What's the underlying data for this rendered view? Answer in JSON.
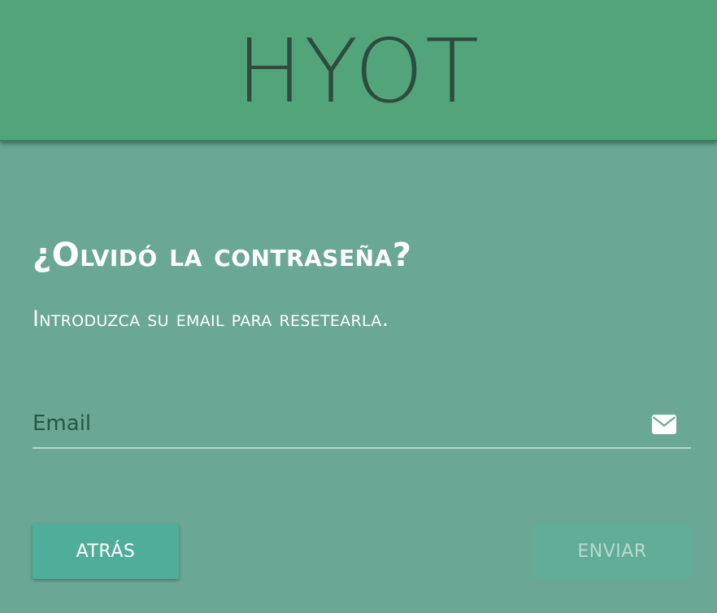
{
  "header": {
    "logo": "HYOT"
  },
  "form": {
    "title": "¿Olvidó la contraseña?",
    "subtitle": "Introduzca su email para resetearla.",
    "email": {
      "value": "",
      "placeholder": "Email",
      "icon": "envelope-icon"
    }
  },
  "buttons": {
    "back_label": "Atrás",
    "send_label": "Enviar"
  },
  "colors": {
    "header": "#52a57a",
    "background": "#6aa795",
    "primary_button": "#4fae99",
    "disabled_button": "#62ad98"
  }
}
